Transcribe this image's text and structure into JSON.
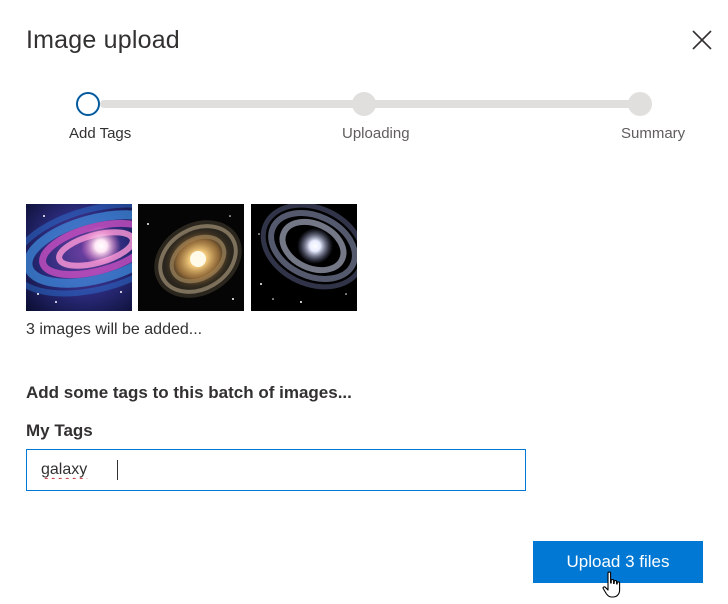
{
  "dialog": {
    "title": "Image upload"
  },
  "stepper": {
    "steps": [
      {
        "label": "Add Tags",
        "state": "active"
      },
      {
        "label": "Uploading",
        "state": "pending"
      },
      {
        "label": "Summary",
        "state": "pending"
      }
    ],
    "active_color": "#005a9e",
    "track_color": "#e1dfdd"
  },
  "images": {
    "thumbnails": [
      {
        "icon": "spiral-galaxy-thumbnail"
      },
      {
        "icon": "spiral-galaxy-thumbnail"
      },
      {
        "icon": "spiral-galaxy-thumbnail"
      }
    ],
    "count_text": "3 images will be added..."
  },
  "tags": {
    "heading": "Add some tags to this batch of images...",
    "label": "My Tags",
    "value": "galaxy"
  },
  "actions": {
    "upload_label": "Upload 3 files",
    "upload_color": "#0078d4"
  }
}
